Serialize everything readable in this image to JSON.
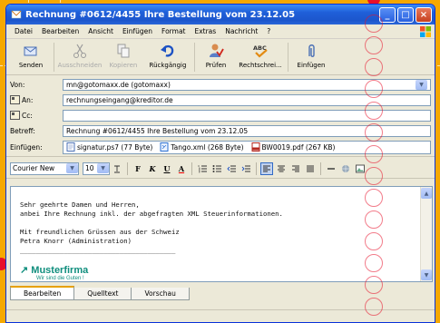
{
  "window": {
    "title": "Rechnung #0612/4455 Ihre Bestellung vom 23.12.05",
    "controls": {
      "minimize": "_",
      "maximize": "□",
      "close": "×"
    }
  },
  "menu": [
    {
      "label": "Datei"
    },
    {
      "label": "Bearbeiten"
    },
    {
      "label": "Ansicht"
    },
    {
      "label": "Einfügen"
    },
    {
      "label": "Format"
    },
    {
      "label": "Extras"
    },
    {
      "label": "Nachricht"
    },
    {
      "label": "?"
    }
  ],
  "toolbar": {
    "send": "Senden",
    "cut": "Ausschneiden",
    "copy": "Kopieren",
    "undo": "Rückgängig",
    "check": "Prüfen",
    "spelling": "Rechtschrei...",
    "insert": "Einfügen"
  },
  "headers": {
    "from_label": "Von:",
    "from_value": "mn@gotomaxx.de   (gotomaxx)",
    "to_label": "An:",
    "to_value": "rechnungseingang@kreditor.de",
    "cc_label": "Cc:",
    "cc_value": "",
    "subject_label": "Betreff:",
    "subject_value": "Rechnung #0612/4455 Ihre Bestellung vom 23.12.05",
    "attach_label": "Einfügen:",
    "attachments": [
      {
        "name": "signatur.ps7 (77 Byte)"
      },
      {
        "name": "Tango.xml (268 Byte)"
      },
      {
        "name": "BW0019.pdf (267 KB)"
      }
    ]
  },
  "format": {
    "font": "Courier New",
    "size": "10",
    "bold": "F",
    "italic": "K",
    "underline": "U",
    "color": "A"
  },
  "body": {
    "text": "Sehr geehrte Damen und Herren,\nanbei Ihre Rechnung inkl. der abgefragten XML Steuerinformationen.\n\nMit freundlichen Grüssen aus der Schweiz\nPetra Knorr (Administration)\n_______________________________________",
    "logo_name": "Musterfirma",
    "logo_slogan": "Wir sind die Guten !"
  },
  "tabs": [
    {
      "label": "Bearbeiten"
    },
    {
      "label": "Quelltext"
    },
    {
      "label": "Vorschau"
    }
  ],
  "colors": {
    "background": "#f6a800",
    "title_blue": "#1f5fd9",
    "logo_green": "#0f8e7d",
    "accent_red": "#e8102a"
  }
}
